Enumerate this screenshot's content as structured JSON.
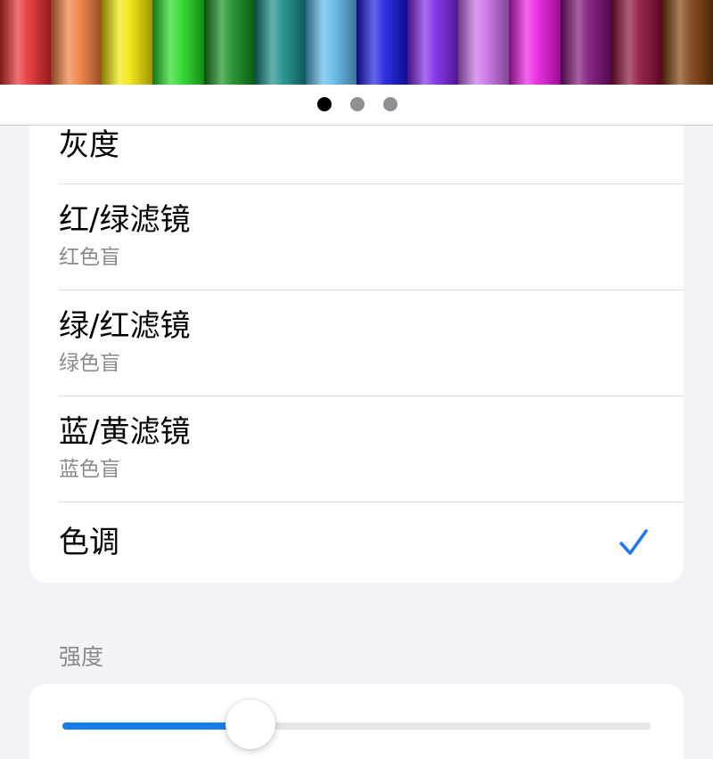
{
  "crayon_strip": {
    "colors": [
      "#e6282b",
      "#f07a3a",
      "#f2e600",
      "#1fd81f",
      "#0f8a1a",
      "#128a84",
      "#5ab6ea",
      "#1515e0",
      "#7b1fe6",
      "#c86be8",
      "#e816e0",
      "#7a0b74",
      "#8a0a33",
      "#7a3a08"
    ]
  },
  "pager": {
    "page_count": 3,
    "current_page": 1
  },
  "filters": {
    "items": [
      {
        "title": "灰度",
        "subtitle": "",
        "selected": false
      },
      {
        "title": "红/绿滤镜",
        "subtitle": "红色盲",
        "selected": false
      },
      {
        "title": "绿/红滤镜",
        "subtitle": "绿色盲",
        "selected": false
      },
      {
        "title": "蓝/黄滤镜",
        "subtitle": "蓝色盲",
        "selected": false
      },
      {
        "title": "色调",
        "subtitle": "",
        "selected": true
      }
    ],
    "check_icon": "checkmark-icon",
    "accent_color": "#1b7bea"
  },
  "intensity": {
    "label": "强度",
    "value": 0.32
  }
}
